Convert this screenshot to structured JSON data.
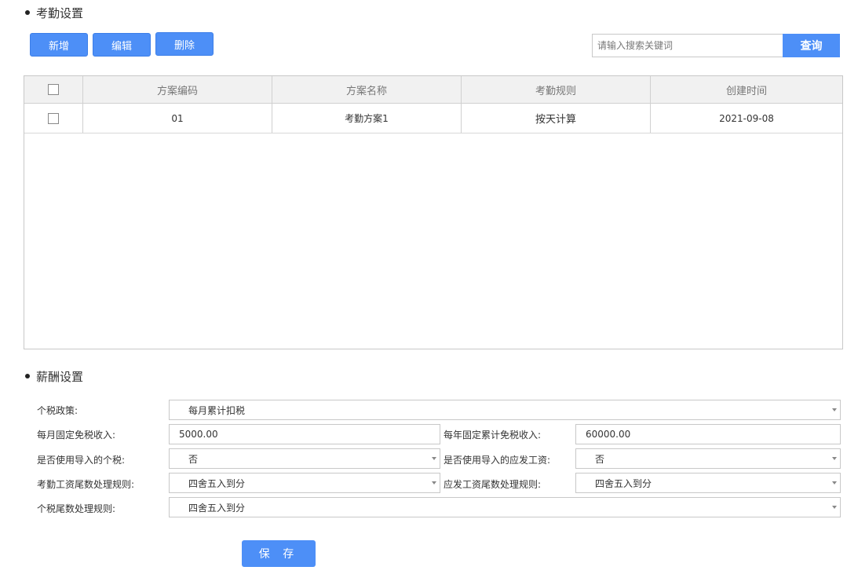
{
  "attendance": {
    "title": "考勤设置",
    "buttons": {
      "add": "新增",
      "edit": "编辑",
      "delete": "删除"
    },
    "search": {
      "placeholder": "请输入搜索关键词",
      "value": "",
      "button": "查询"
    },
    "table": {
      "columns": [
        "方案编码",
        "方案名称",
        "考勤规则",
        "创建时间"
      ],
      "rows": [
        {
          "code": "01",
          "name": "考勤方案1",
          "rule": "按天计算",
          "created": "2021-09-08"
        }
      ]
    }
  },
  "salary": {
    "title": "薪酬设置",
    "fields": {
      "tax_policy": {
        "label": "个税政策:",
        "value": "每月累计扣税"
      },
      "monthly_exempt": {
        "label": "每月固定免税收入:",
        "value": "5000.00"
      },
      "yearly_exempt": {
        "label": "每年固定累计免税收入:",
        "value": "60000.00"
      },
      "use_imported_tax": {
        "label": "是否使用导入的个税:",
        "value": "否"
      },
      "use_imported_wage": {
        "label": "是否使用导入的应发工资:",
        "value": "否"
      },
      "attendance_rounding": {
        "label": "考勤工资尾数处理规则:",
        "value": "四舍五入到分"
      },
      "wage_rounding": {
        "label": "应发工资尾数处理规则:",
        "value": "四舍五入到分"
      },
      "tax_rounding": {
        "label": "个税尾数处理规则:",
        "value": "四舍五入到分"
      }
    },
    "save_label": "保 存"
  },
  "colors": {
    "accent": "#4d8ff7",
    "border": "#c8c8c8",
    "header_bg": "#f1f1f1"
  }
}
